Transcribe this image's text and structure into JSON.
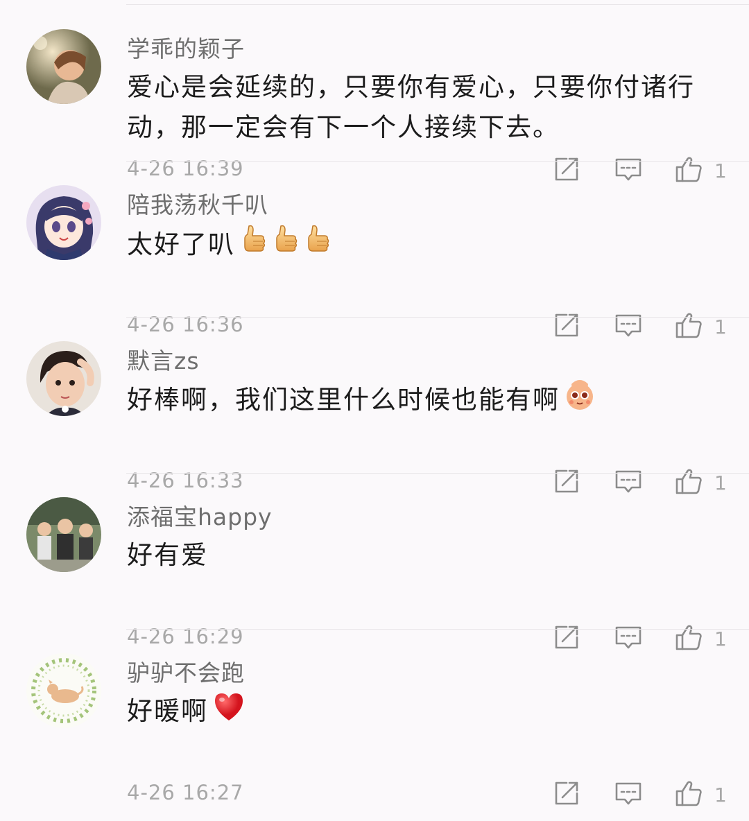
{
  "comments": [
    {
      "username": "学乖的颖子",
      "text": "爱心是会延续的，只要你有爱心，只要你付诸行动，那一定会有下一个人接续下去。",
      "time": "4-26 16:39",
      "likes": "1",
      "emoji": []
    },
    {
      "username": "陪我荡秋千叭",
      "text": "太好了叭",
      "time": "4-26 16:36",
      "likes": "1",
      "emoji": [
        "thumbs-up-emoji",
        "thumbs-up-emoji",
        "thumbs-up-emoji"
      ]
    },
    {
      "username": "默言zs",
      "text": "好棒啊，我们这里什么时候也能有啊",
      "time": "4-26 16:33",
      "likes": "1",
      "emoji": [
        "cute-face-emoji"
      ]
    },
    {
      "username": "添福宝happy",
      "text": "好有爱",
      "time": "4-26 16:29",
      "likes": "1",
      "emoji": []
    },
    {
      "username": "驴驴不会跑",
      "text": "好暖啊",
      "time": "4-26 16:27",
      "likes": "1",
      "emoji": [
        "red-heart-emoji"
      ]
    }
  ],
  "icons": {
    "share": "share-icon",
    "reply": "comment-icon",
    "like": "thumbs-up-icon"
  },
  "colors": {
    "background": "#fbf9fb",
    "username": "#6e6e6e",
    "text": "#1c1c1c",
    "meta": "#a8a8a8",
    "divider": "#e9e6e9"
  }
}
